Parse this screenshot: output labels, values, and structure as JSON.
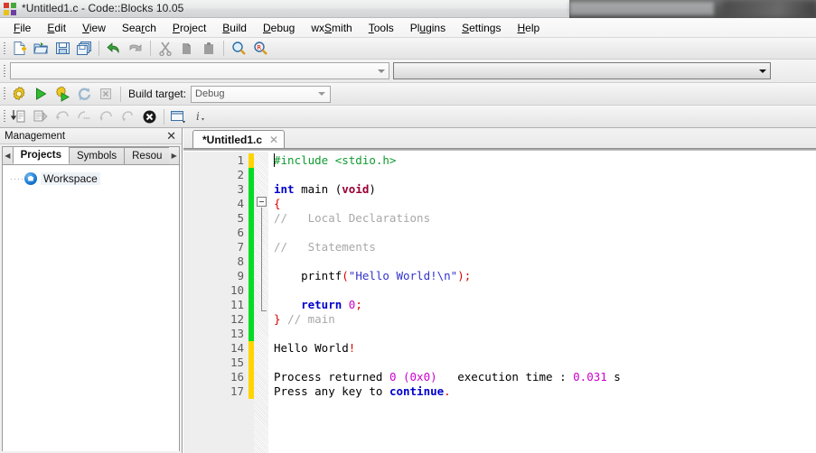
{
  "window": {
    "title": "*Untitled1.c - Code::Blocks 10.05",
    "logo_icon": "codeblocks-logo-icon"
  },
  "menubar": {
    "items": [
      {
        "label": "File",
        "accel": "F"
      },
      {
        "label": "Edit",
        "accel": "E"
      },
      {
        "label": "View",
        "accel": "V"
      },
      {
        "label": "Search",
        "accel": "r"
      },
      {
        "label": "Project",
        "accel": "P"
      },
      {
        "label": "Build",
        "accel": "B"
      },
      {
        "label": "Debug",
        "accel": "D"
      },
      {
        "label": "wxSmith",
        "accel": "S"
      },
      {
        "label": "Tools",
        "accel": "T"
      },
      {
        "label": "Plugins",
        "accel": "u"
      },
      {
        "label": "Settings",
        "accel": "S"
      },
      {
        "label": "Help",
        "accel": "H"
      }
    ]
  },
  "main_toolbar": {
    "buttons": [
      {
        "name": "new-file-icon",
        "title": "New file"
      },
      {
        "name": "open-folder-icon",
        "title": "Open"
      },
      {
        "name": "save-icon",
        "title": "Save"
      },
      {
        "name": "save-all-icon",
        "title": "Save all"
      },
      {
        "name": "undo-icon",
        "title": "Undo"
      },
      {
        "name": "redo-icon",
        "title": "Redo"
      },
      {
        "name": "cut-scissors-icon",
        "title": "Cut"
      },
      {
        "name": "copy-icon",
        "title": "Copy"
      },
      {
        "name": "paste-icon",
        "title": "Paste"
      },
      {
        "name": "find-magnifier-icon",
        "title": "Find"
      },
      {
        "name": "replace-icon",
        "title": "Replace"
      }
    ]
  },
  "search_toolbar": {
    "scope_combo_value": "",
    "function_combo_value": ""
  },
  "build_toolbar": {
    "buttons": [
      {
        "name": "build-gear-icon",
        "title": "Build"
      },
      {
        "name": "run-triangle-icon",
        "title": "Run"
      },
      {
        "name": "build-and-run-icon",
        "title": "Build and run"
      },
      {
        "name": "rebuild-icon",
        "title": "Rebuild"
      },
      {
        "name": "abort-icon",
        "title": "Abort"
      }
    ],
    "target_label": "Build target:",
    "target_value": "Debug"
  },
  "debug_toolbar": {
    "buttons": [
      {
        "name": "debug-continue-icon",
        "title": "Debug / Continue"
      },
      {
        "name": "run-to-cursor-icon",
        "title": "Run to cursor"
      },
      {
        "name": "next-line-icon",
        "title": "Next line"
      },
      {
        "name": "next-instruction-icon",
        "title": "Next instruction"
      },
      {
        "name": "step-into-icon",
        "title": "Step into"
      },
      {
        "name": "step-out-icon",
        "title": "Step out"
      },
      {
        "name": "stop-debugger-icon",
        "title": "Stop debugger"
      },
      {
        "name": "debug-windows-icon",
        "title": "Debugging windows"
      },
      {
        "name": "various-info-icon",
        "title": "Various info"
      }
    ]
  },
  "management": {
    "title": "Management",
    "close_label": "✕",
    "prev_arrow": "◀",
    "next_arrow": "▶",
    "tabs": [
      {
        "label": "Projects",
        "active": true
      },
      {
        "label": "Symbols",
        "active": false
      },
      {
        "label": "Resou",
        "active": false
      }
    ],
    "tree": {
      "dots": "····",
      "root_label": "Workspace",
      "root_icon": "workspace-home-icon"
    }
  },
  "editor": {
    "tab_label": "*Untitled1.c",
    "tab_close": "✕",
    "line_numbers": [
      1,
      2,
      3,
      4,
      5,
      6,
      7,
      8,
      9,
      10,
      11,
      12,
      13,
      14,
      15,
      16,
      17
    ],
    "change_segments": [
      {
        "color": "yellow",
        "lines": 1
      },
      {
        "color": "green",
        "lines": 12
      },
      {
        "color": "yellow",
        "lines": 4
      }
    ],
    "lines": [
      {
        "n": 1,
        "tokens": [
          {
            "t": "#include <stdio.h>",
            "c": "k-pre"
          }
        ]
      },
      {
        "n": 2,
        "tokens": []
      },
      {
        "n": 3,
        "tokens": [
          {
            "t": "int",
            "c": "k-kw"
          },
          {
            "t": " main (",
            "c": "k-plain"
          },
          {
            "t": "void",
            "c": "k-type"
          },
          {
            "t": ")",
            "c": "k-plain"
          }
        ]
      },
      {
        "n": 4,
        "tokens": [
          {
            "t": "{",
            "c": "k-punc"
          }
        ]
      },
      {
        "n": 5,
        "tokens": [
          {
            "t": "//   Local Declarations",
            "c": "k-com"
          }
        ]
      },
      {
        "n": 6,
        "tokens": []
      },
      {
        "n": 7,
        "tokens": [
          {
            "t": "//   Statements",
            "c": "k-com"
          }
        ]
      },
      {
        "n": 8,
        "tokens": []
      },
      {
        "n": 9,
        "tokens": [
          {
            "t": "    printf",
            "c": "k-plain"
          },
          {
            "t": "(",
            "c": "k-punc"
          },
          {
            "t": "\"Hello World!\\n\"",
            "c": "k-str"
          },
          {
            "t": ");",
            "c": "k-punc"
          }
        ]
      },
      {
        "n": 10,
        "tokens": []
      },
      {
        "n": 11,
        "tokens": [
          {
            "t": "    ",
            "c": "k-plain"
          },
          {
            "t": "return",
            "c": "k-kw"
          },
          {
            "t": " ",
            "c": "k-plain"
          },
          {
            "t": "0",
            "c": "k-num"
          },
          {
            "t": ";",
            "c": "k-punc"
          }
        ]
      },
      {
        "n": 12,
        "tokens": [
          {
            "t": "}",
            "c": "k-punc"
          },
          {
            "t": " ",
            "c": "k-plain"
          },
          {
            "t": "// main",
            "c": "k-com"
          }
        ]
      },
      {
        "n": 13,
        "tokens": []
      },
      {
        "n": 14,
        "tokens": [
          {
            "t": "Hello World",
            "c": "k-plain"
          },
          {
            "t": "!",
            "c": "k-punc"
          }
        ]
      },
      {
        "n": 15,
        "tokens": []
      },
      {
        "n": 16,
        "tokens": [
          {
            "t": "Process returned ",
            "c": "k-plain"
          },
          {
            "t": "0 (0x0)",
            "c": "k-num"
          },
          {
            "t": "   execution time : ",
            "c": "k-plain"
          },
          {
            "t": "0.031",
            "c": "k-num"
          },
          {
            "t": " s",
            "c": "k-plain"
          }
        ]
      },
      {
        "n": 17,
        "tokens": [
          {
            "t": "Press any key to ",
            "c": "k-plain"
          },
          {
            "t": "continue",
            "c": "k-kw"
          },
          {
            "t": ".",
            "c": "k-punc"
          }
        ]
      }
    ]
  },
  "colors": {
    "change_unsaved": "#ffd400",
    "change_saved": "#00dd22",
    "preprocessor": "#0f9b2e",
    "keyword": "#0000cc",
    "type": "#990033",
    "string": "#3333cc",
    "punctuation": "#dd0000",
    "number": "#cc00cc",
    "comment": "#a8a8a8"
  }
}
